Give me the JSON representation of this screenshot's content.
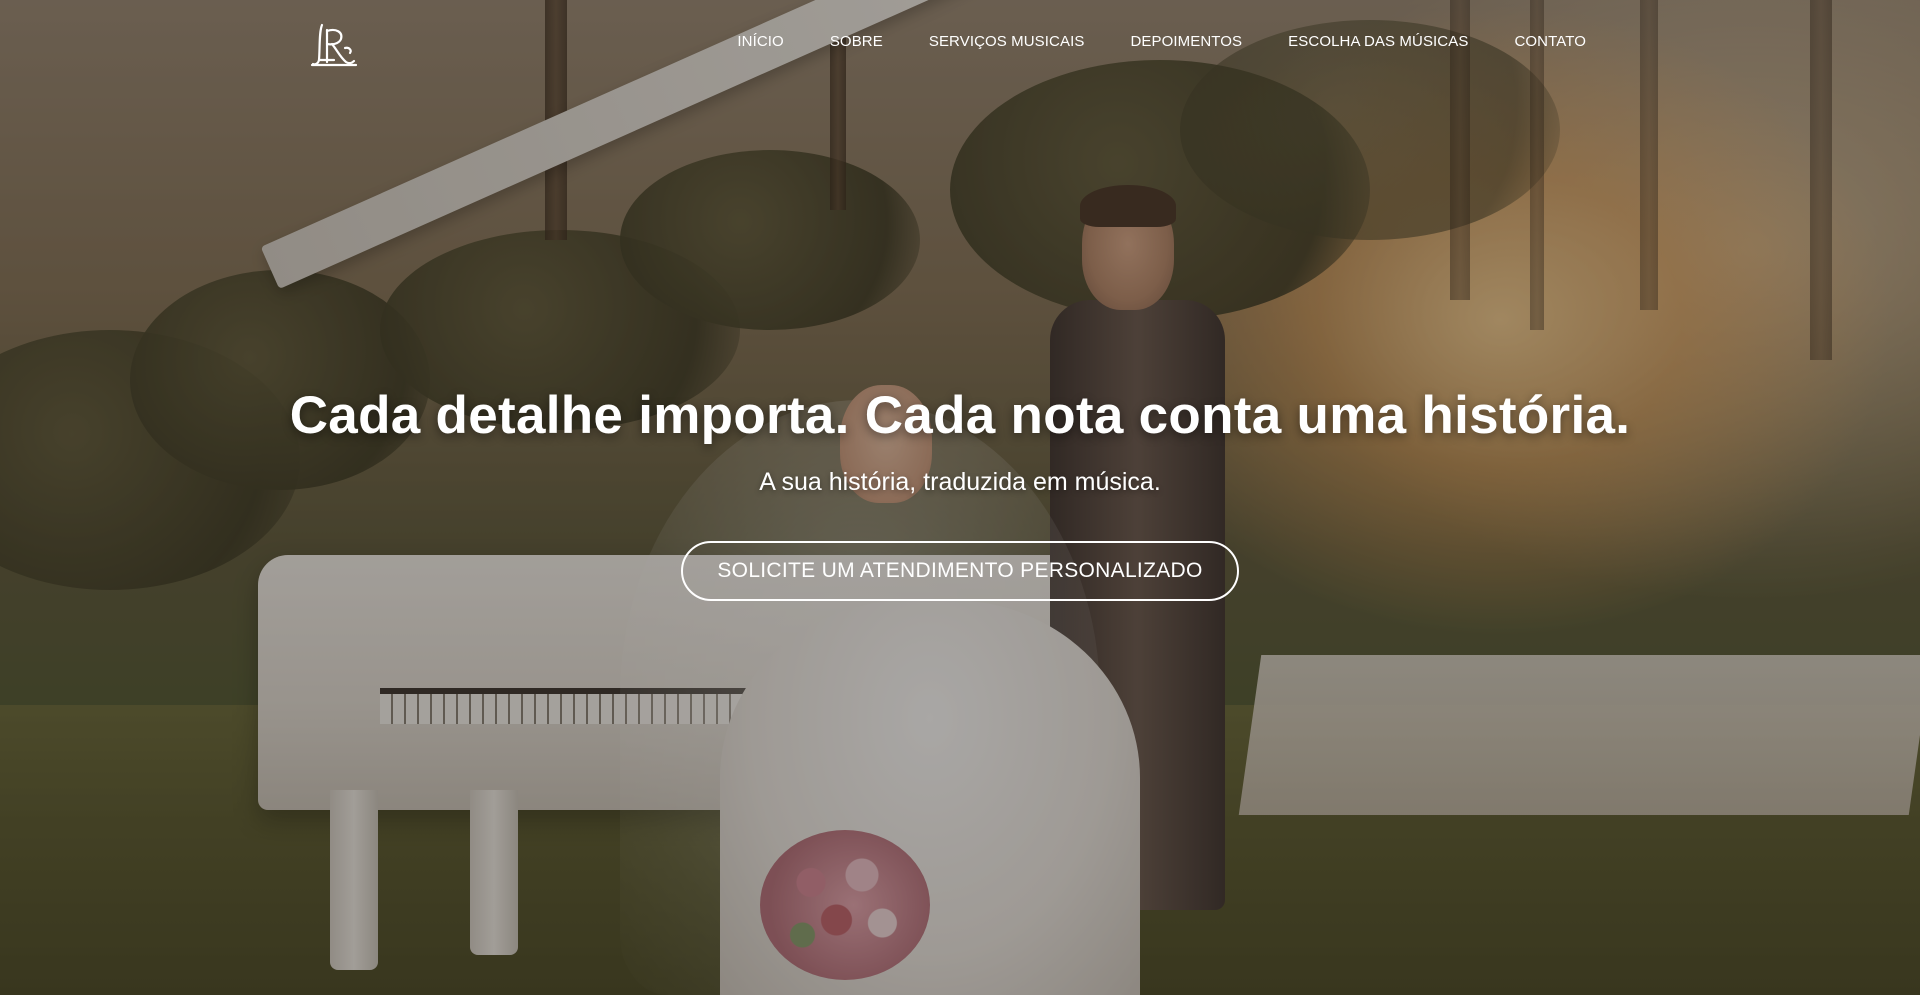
{
  "header": {
    "logo_text": "LR",
    "nav": [
      {
        "label": "INÍCIO"
      },
      {
        "label": "SOBRE"
      },
      {
        "label": "SERVIÇOS MUSICAIS"
      },
      {
        "label": "DEPOIMENTOS"
      },
      {
        "label": "ESCOLHA DAS MÚSICAS"
      },
      {
        "label": "CONTATO"
      }
    ]
  },
  "hero": {
    "headline": "Cada detalhe importa. Cada nota conta uma história.",
    "subheadline": "A sua história, traduzida em música.",
    "cta_label": "SOLICITE UM ATENDIMENTO PERSONALIZADO",
    "background_image": "wedding-couple-white-grand-piano-photo",
    "colors": {
      "text": "#ffffff",
      "overlay": "#1e1812",
      "cta_border": "#ffffff"
    }
  }
}
